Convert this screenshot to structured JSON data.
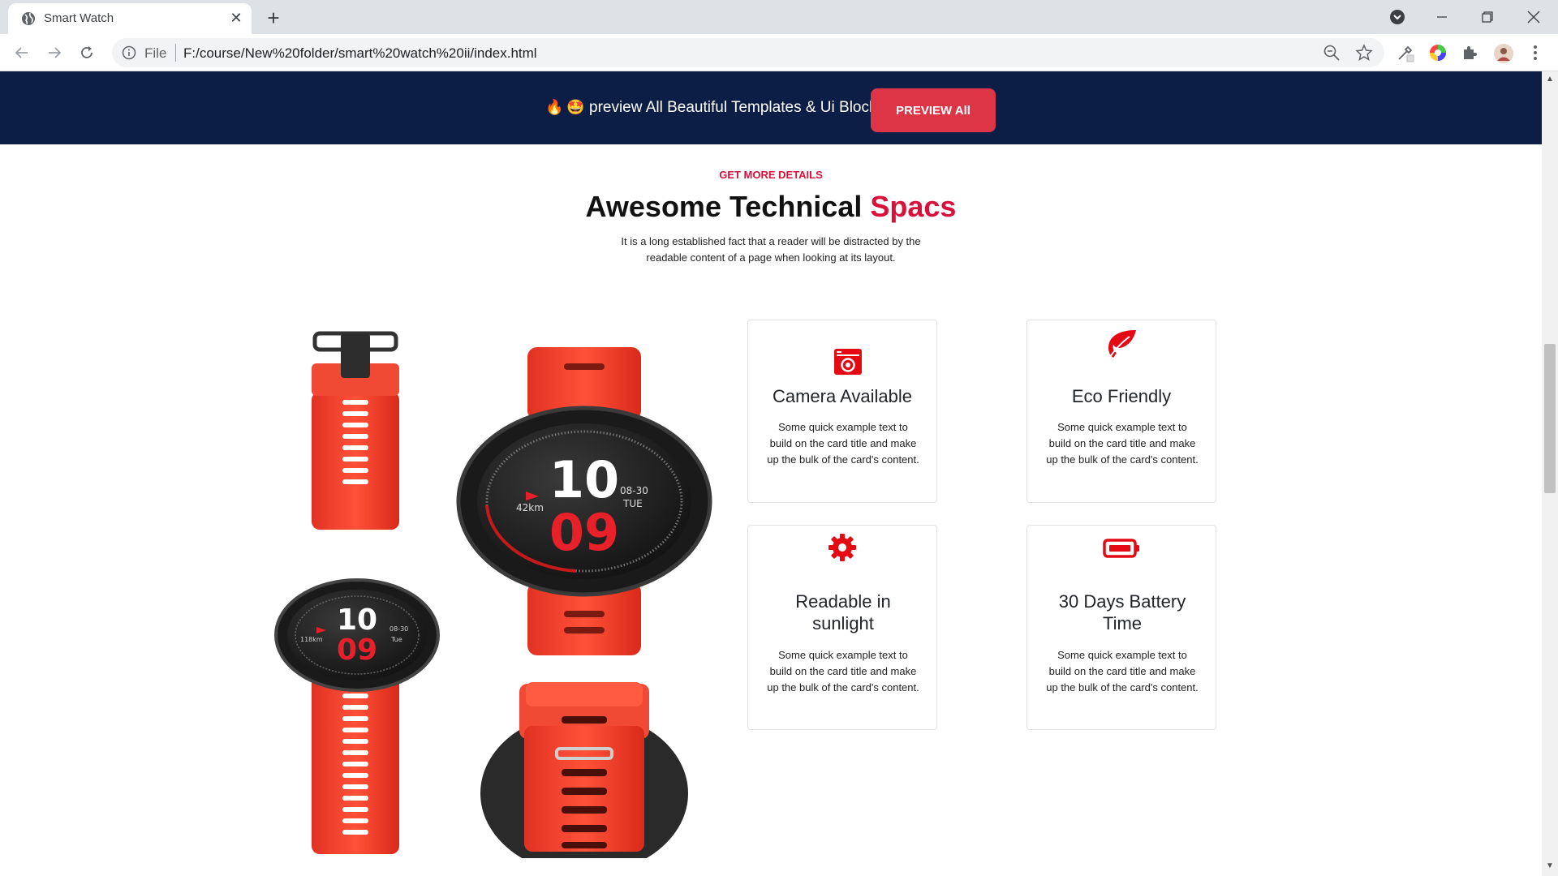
{
  "browser": {
    "tab_title": "Smart Watch",
    "omnibox_scheme": "File",
    "url": "F:/course/New%20folder/smart%20watch%20ii/index.html"
  },
  "banner": {
    "emoji1": "🔥",
    "emoji2": "🤩",
    "text": "preview All Beautiful Templates & Ui Blocks",
    "button_label": "PREVIEW All"
  },
  "section": {
    "eyebrow": "GET MORE DETAILS",
    "title_main": "Awesome Technical",
    "title_accent": "Spacs",
    "description": "It is a long established fact that a reader will be distracted by the readable content of a page when looking at its layout."
  },
  "watches": {
    "large": {
      "hour": "10",
      "minute": "09",
      "date": "08-30",
      "day": "Tue",
      "distance": "118km"
    },
    "front": {
      "hour": "10",
      "minute": "09",
      "date": "08-30",
      "day": "TUE",
      "distance": "42km"
    }
  },
  "cards": [
    {
      "icon": "camera-icon",
      "title": "Camera Available",
      "text": "Some quick example text to build on the card title and make up the bulk of the card's content."
    },
    {
      "icon": "leaf-icon",
      "title": "Eco Friendly",
      "text": "Some quick example text to build on the card title and make up the bulk of the card's content."
    },
    {
      "icon": "gear-icon",
      "title": "Readable in sunlight",
      "text": "Some quick example text to build on the card title and make up the bulk of the card's content."
    },
    {
      "icon": "battery-icon",
      "title": "30 Days Battery Time",
      "text": "Some quick example text to build on the card title and make up the bulk of the card's content."
    }
  ],
  "colors": {
    "banner_bg": "#0c1e46",
    "accent": "#d9103b",
    "button": "#dd3446",
    "strap": "#f5402d"
  }
}
